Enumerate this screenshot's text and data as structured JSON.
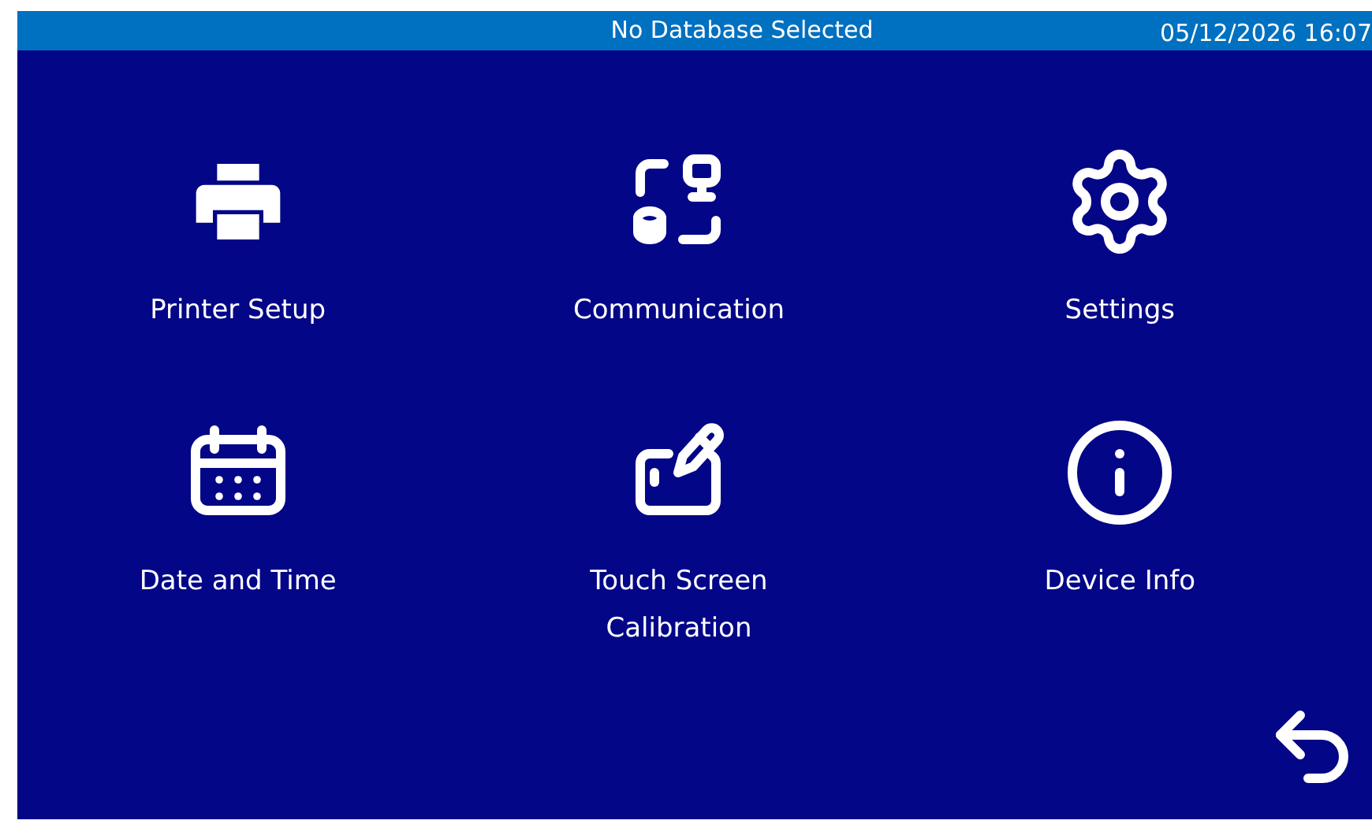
{
  "status_bar": {
    "title": "No Database Selected",
    "datetime": "05/12/2026 16:07"
  },
  "menu_items": [
    {
      "kind": "printer",
      "label": "Printer Setup"
    },
    {
      "kind": "communication",
      "label": "Communication"
    },
    {
      "kind": "settings",
      "label": "Settings"
    },
    {
      "kind": "calendar",
      "label": "Date and Time"
    },
    {
      "kind": "touch",
      "label": "Touch Screen Calibration"
    },
    {
      "kind": "info",
      "label": "Device Info"
    }
  ]
}
